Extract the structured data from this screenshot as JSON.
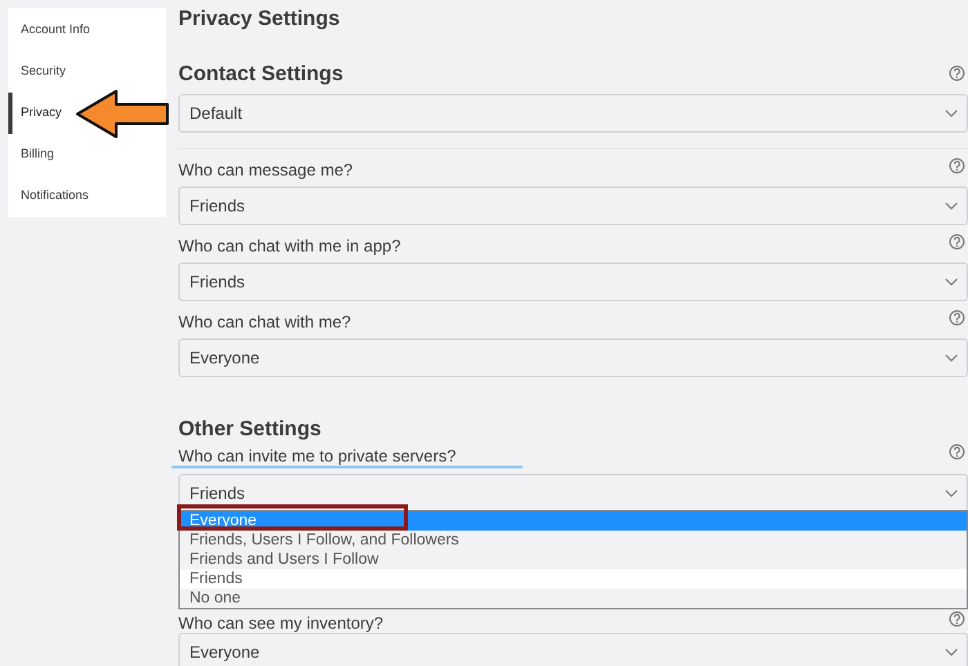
{
  "sidebar": {
    "items": [
      {
        "label": "Account Info",
        "selected": false
      },
      {
        "label": "Security",
        "selected": false
      },
      {
        "label": "Privacy",
        "selected": true
      },
      {
        "label": "Billing",
        "selected": false
      },
      {
        "label": "Notifications",
        "selected": false
      }
    ]
  },
  "page_title": "Privacy Settings",
  "sections": [
    {
      "title": "Contact Settings",
      "help": true,
      "settings": [
        {
          "value": "Default"
        },
        {
          "label": "Who can message me?",
          "value": "Friends"
        },
        {
          "label": "Who can chat with me in app?",
          "value": "Friends"
        },
        {
          "label": "Who can chat with me?",
          "value": "Everyone"
        }
      ]
    },
    {
      "title": "Other Settings",
      "help": false,
      "settings": [
        {
          "label": "Who can invite me to private servers?",
          "value": "Friends",
          "expanded": true,
          "options": [
            {
              "label": "Everyone",
              "highlighted": true,
              "selected": false
            },
            {
              "label": "Friends, Users I Follow, and Followers",
              "highlighted": false,
              "selected": false
            },
            {
              "label": "Friends and Users I Follow",
              "highlighted": false,
              "selected": false
            },
            {
              "label": "Friends",
              "highlighted": false,
              "selected": true
            },
            {
              "label": "No one",
              "highlighted": false,
              "selected": false
            }
          ]
        },
        {
          "label": "Who can see my inventory?",
          "value": "Everyone"
        }
      ]
    }
  ],
  "annotations": [
    {
      "kind": "arrow"
    },
    {
      "kind": "underline"
    },
    {
      "kind": "box"
    }
  ]
}
